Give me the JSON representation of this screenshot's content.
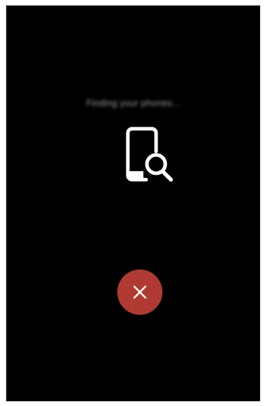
{
  "screen": {
    "status_text": "Finding your phones..."
  },
  "icons": {
    "main": "phone-search-icon",
    "cancel": "close-icon"
  },
  "colors": {
    "background": "#000000",
    "cancel_button": "#b03a32",
    "icon": "#ffffff"
  }
}
